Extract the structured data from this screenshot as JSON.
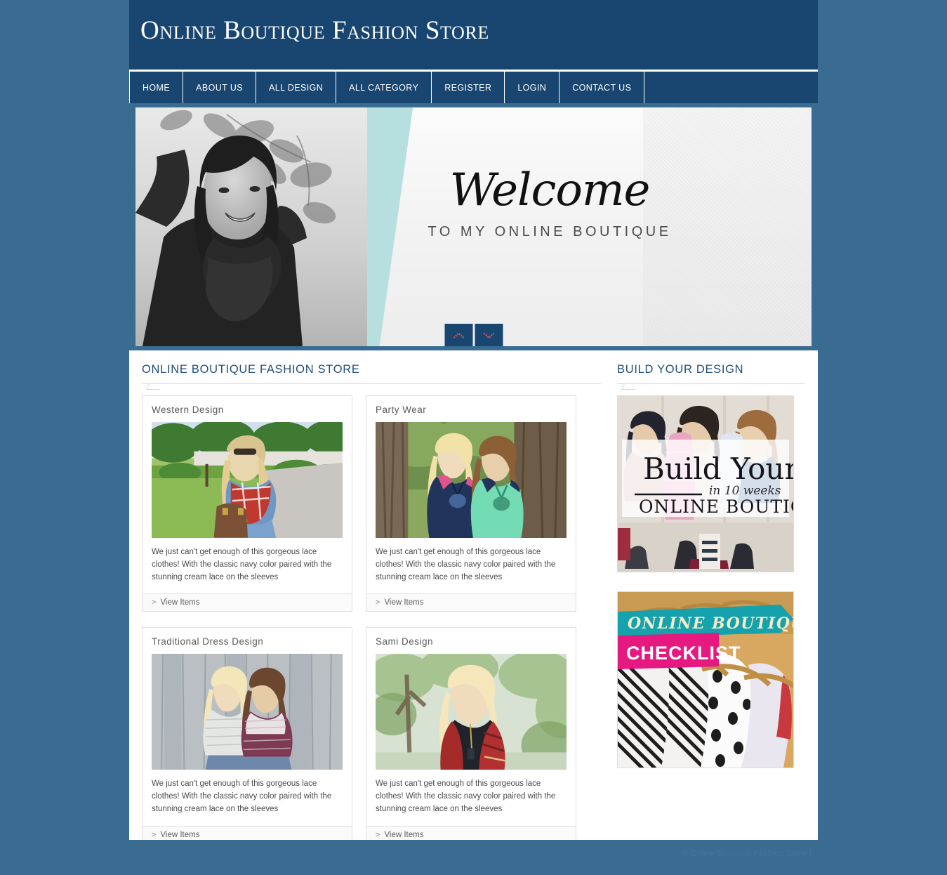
{
  "site": {
    "title": "Online Boutique Fashion Store",
    "colors": {
      "header_navy": "#184671",
      "page_background": "#3a6c92",
      "heading_blue": "#1f4f7c",
      "hero_teal": "#b8dfe0"
    }
  },
  "nav": {
    "items": [
      {
        "label": "HOME"
      },
      {
        "label": "ABOUT US"
      },
      {
        "label": "ALL DESIGN"
      },
      {
        "label": "ALL CATEGORY"
      },
      {
        "label": "REGISTER"
      },
      {
        "label": "LOGIN"
      },
      {
        "label": "CONTACT US"
      }
    ]
  },
  "hero": {
    "welcome": "Welcome",
    "subtitle": "TO MY ONLINE BOUTIQUE",
    "prev_icon": "chevron-up-icon",
    "next_icon": "chevron-down-icon"
  },
  "main": {
    "section_title": "ONLINE BOUTIQUE FASHION STORE",
    "cards": [
      {
        "title": "Western Design",
        "description": "We just can't get enough of this gorgeous lace clothes! With the classic navy color paired with the stunning cream lace on the sleeves",
        "link_label": "View Items",
        "link_arrow": ">"
      },
      {
        "title": "Party Wear",
        "description": "We just can't get enough of this gorgeous lace clothes! With the classic navy color paired with the stunning cream lace on the sleeves",
        "link_label": "View Items",
        "link_arrow": ">"
      },
      {
        "title": "Traditional Dress Design",
        "description": "We just can't get enough of this gorgeous lace clothes! With the classic navy color paired with the stunning cream lace on the sleeves",
        "link_label": "View Items",
        "link_arrow": ">"
      },
      {
        "title": "Sami Design",
        "description": "We just can't get enough of this gorgeous lace clothes! With the classic navy color paired with the stunning cream lace on the sleeves",
        "link_label": "View Items",
        "link_arrow": ">"
      }
    ]
  },
  "sidebar": {
    "section_title": "BUILD YOUR DESIGN",
    "banners": [
      {
        "name": "build-your-online-boutique-banner",
        "line1": "Build Your",
        "line2": "in 10 weeks",
        "line3": "ONLINE BOUTIQUE"
      },
      {
        "name": "online-boutique-checklist-banner",
        "line1": "ONLINE BOUTIQUE",
        "line2": "CHECKLIST"
      }
    ]
  },
  "footer": {
    "copyright": "© Online Boutique Fashion Store  |"
  }
}
